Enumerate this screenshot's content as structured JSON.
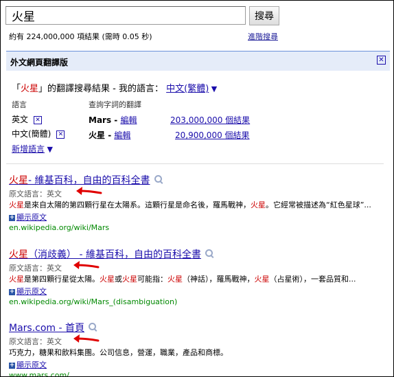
{
  "search": {
    "query": "火星",
    "button_label": "搜尋"
  },
  "stats": {
    "text": "約有 224,000,000 項結果 (需時 0.05 秒)",
    "advanced_link": "進階搜尋"
  },
  "panel": {
    "title": "外文網頁翻譯版",
    "close_icon": "close-icon",
    "trans_open_quote": "「",
    "trans_query": "火星",
    "trans_rest": "」的翻譯搜尋結果 - 我的語言：",
    "my_language": "中文(繁體)",
    "col_language": "語言",
    "col_translation": "查詢字詞的翻譯",
    "languages": [
      {
        "name": "英文",
        "term": "Mars",
        "edit": "編輯",
        "count": "203,000,000 個結果"
      },
      {
        "name": "中文(簡體)",
        "term": "火星",
        "edit": "編輯",
        "count": "20,900,000 個結果"
      }
    ],
    "add_language": "新增語言"
  },
  "results": [
    {
      "title_red": "火星",
      "title_rest": "- 維基百科，自由的百科全書",
      "lang_label": "原文語言：英文",
      "snippet": [
        {
          "t": "火星",
          "hl": true
        },
        {
          "t": "是來自太陽的第四顆行星在太陽系。這顆行星是命名後，羅馬戰神，",
          "hl": false
        },
        {
          "t": "火星",
          "hl": true
        },
        {
          "t": "。它經常被描述為“紅色星球”...",
          "hl": false
        }
      ],
      "show_original": "顯示原文",
      "url": "en.wikipedia.org/wiki/Mars"
    },
    {
      "title_red": "火星",
      "title_rest": "（消歧義） - 維基百科，自由的百科全書",
      "lang_label": "原文語言：英文",
      "snippet": [
        {
          "t": "火星",
          "hl": true
        },
        {
          "t": "是第四顆行星從太陽。",
          "hl": false
        },
        {
          "t": "火星",
          "hl": true
        },
        {
          "t": "或",
          "hl": false
        },
        {
          "t": "火星",
          "hl": true
        },
        {
          "t": "可能指：",
          "hl": false
        },
        {
          "t": "火星",
          "hl": true
        },
        {
          "t": "（神話），羅馬戰神，",
          "hl": false
        },
        {
          "t": "火星",
          "hl": true
        },
        {
          "t": "（占星術），一套品質和...",
          "hl": false
        }
      ],
      "show_original": "顯示原文",
      "url": "en.wikipedia.org/wiki/Mars_(disambiguation)"
    },
    {
      "title_red": "",
      "title_rest": "Mars.com - 首頁",
      "lang_label": "原文語言：英文",
      "snippet": [
        {
          "t": "巧克力，糖果和飲料集團。公司信息，營運，職業，產品和商標。",
          "hl": false
        }
      ],
      "show_original": "顯示原文",
      "url": "www.mars.com/"
    }
  ],
  "colors": {
    "link": "#1a0dab",
    "highlight": "#cc0000",
    "url": "#008000",
    "panel_bg": "#e5ecf9",
    "arrow": "#e00000"
  }
}
